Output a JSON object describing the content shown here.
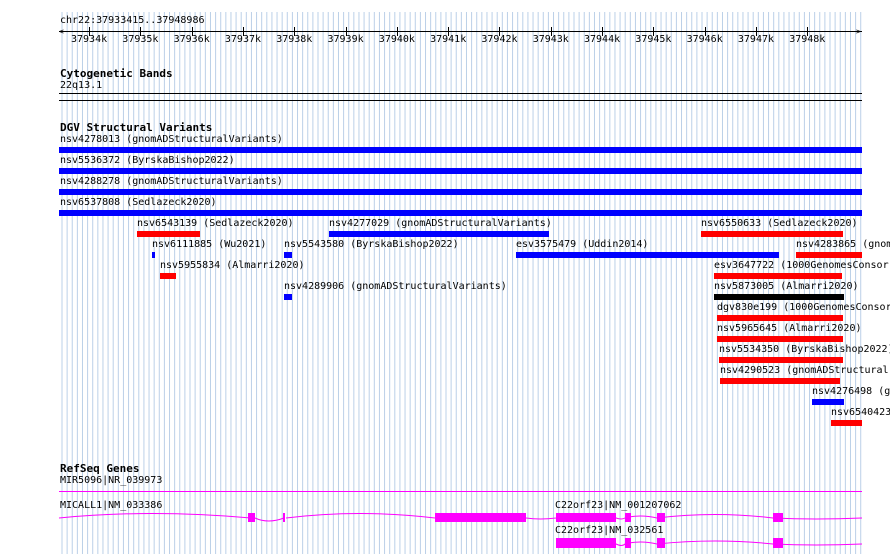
{
  "location": "chr22:37933415..37948986",
  "ruler_ticks": [
    "37934k",
    "37935k",
    "37936k",
    "37937k",
    "37938k",
    "37939k",
    "37940k",
    "37941k",
    "37942k",
    "37943k",
    "37944k",
    "37945k",
    "37946k",
    "37947k",
    "37948k"
  ],
  "tracks": {
    "cytoband": {
      "title": "Cytogenetic Bands",
      "band": "22q13.1"
    },
    "dgv": {
      "title": "DGV Structural Variants",
      "features": [
        {
          "label": "nsv4278013 (gnomADStructuralVariants)",
          "color": "#0000ff"
        },
        {
          "label": "nsv5536372 (ByrskaBishop2022)",
          "color": "#0000ff"
        },
        {
          "label": "nsv4288278 (gnomADStructuralVariants)",
          "color": "#0000ff"
        },
        {
          "label": "nsv6537808 (Sedlazeck2020)",
          "color": "#0000ff"
        },
        {
          "label": "nsv6543139 (Sedlazeck2020)",
          "color": "#ff0000"
        },
        {
          "label": "nsv4277029 (gnomADStructuralVariants)",
          "color": "#0000ff"
        },
        {
          "label": "nsv6550633 (Sedlazeck2020)",
          "color": "#ff0000"
        },
        {
          "label": "nsv6111885 (Wu2021)",
          "color": "#0000ff"
        },
        {
          "label": "nsv5543580 (ByrskaBishop2022)",
          "color": "#0000ff"
        },
        {
          "label": "esv3575479 (Uddin2014)",
          "color": "#0000ff"
        },
        {
          "label": "nsv4283865 (gnom",
          "color": "#ff0000"
        },
        {
          "label": "nsv5955834 (Almarri2020)",
          "color": "#ff0000"
        },
        {
          "label": "esv3647722 (1000GenomesConsor",
          "color": "#ff0000"
        },
        {
          "label": "nsv4289906 (gnomADStructuralVariants)",
          "color": "#0000ff"
        },
        {
          "label": "nsv5873005 (Almarri2020)",
          "color": "#000000"
        },
        {
          "label": "dgv830e199 (1000GenomesConsor",
          "color": "#ff0000"
        },
        {
          "label": "nsv5965645 (Almarri2020)",
          "color": "#ff0000"
        },
        {
          "label": "nsv5534350 (ByrskaBishop2022)",
          "color": "#ff0000"
        },
        {
          "label": "nsv4290523 (gnomADStructural",
          "color": "#ff0000"
        },
        {
          "label": "nsv4276498 (g",
          "color": "#0000ff"
        },
        {
          "label": "nsv6540423",
          "color": "#ff0000"
        }
      ]
    },
    "refseq": {
      "title": "RefSeq Genes",
      "genes": [
        {
          "label": "MIR5096|NR_039973"
        },
        {
          "label": "MICALL1|NM_033386"
        },
        {
          "label": "C22orf23|NM_001207062"
        },
        {
          "label": "C22orf23|NM_032561"
        }
      ]
    }
  },
  "colors": {
    "grid": "#bbd0e8",
    "gain": "#0000ff",
    "loss": "#ff0000",
    "gene": "#ff00ff"
  }
}
